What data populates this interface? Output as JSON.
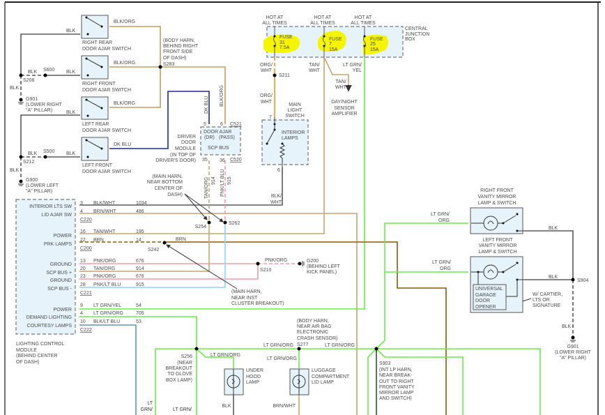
{
  "colors": {
    "blk": "#5a5a5a",
    "blk_org": "#c89a62",
    "org_wht": "#f7941d",
    "tan": "#c8a46e",
    "brn": "#8b5a00",
    "lt_grn": "#66ee44",
    "pnk": "#f59aa5",
    "lt_blu": "#8fd3f4",
    "dk_blu": "#1a2a8c",
    "fuse_highlight": "#f5f500",
    "module_fill": "#e6f3fa"
  },
  "door_switches": [
    {
      "name": [
        "RIGHT REAR",
        "DOOR AJAR SWITCH"
      ],
      "out_wire": "BLK/ORG",
      "in_wire": "BLK"
    },
    {
      "name": [
        "RIGHT FRONT",
        "DOOR AJAR SWITCH"
      ],
      "out_wire": "BLK/ORG",
      "in_wire": "BLK"
    },
    {
      "name": [
        "LEFT REAR",
        "DOOR AJAR SWITCH"
      ],
      "out_wire": "BLK/ORG",
      "in_wire": "BLK"
    },
    {
      "name": [
        "LEFT FRONT",
        "DOOR AJAR SWITCH"
      ],
      "out_wire": "DK BLU",
      "in_wire": "BLK"
    }
  ],
  "splices": {
    "s208": "S208",
    "s600": "S600",
    "s212": "S212",
    "s500": "S500",
    "s283": "S283",
    "s211": "S211",
    "s254": "S254",
    "s262": "S262",
    "s242": "S242",
    "s210": "S210",
    "s256": "S256",
    "s277": "S277",
    "s903": "S903",
    "s904": "S904"
  },
  "grounds": {
    "g901_left": [
      "G901",
      "(LOWER RIGHT",
      "\"A\" PILLAR)"
    ],
    "g900": [
      "G900",
      "(LOWER LEFT",
      "\"A\" PILLAR)"
    ],
    "g200": [
      "G200",
      "(BEHIND LEFT",
      "KICK PANEL)"
    ],
    "g901_right": [
      "G901",
      "(LOWER RIGHT",
      "\"A\" PILLAR)"
    ]
  },
  "notes": {
    "s283": [
      "(BODY HARN,",
      "BEHIND RIGHT",
      "FRONT SIDE",
      "OF DASH)"
    ],
    "main_harn_bottom": [
      "(MAIN HARN,",
      "NEAR BOTTOM",
      "CENTER OF",
      "DASH)"
    ],
    "main_harn_inst": [
      "(MAIN HARN,",
      "NEAR INST",
      "CLUSTER BREAKOUT)"
    ],
    "s256": [
      "(NEAR",
      "BREAKOUT",
      "TO GLOVE",
      "BOX LAMP)"
    ],
    "s277": [
      "(BODY HARN,",
      "NEAR AIR BAG",
      "ELECTRONIC",
      "CRASH SENSOR)"
    ],
    "s903": [
      "(INT LP HARN,",
      "NEAR BREAK-",
      "OUT TO RIGHT",
      "FRONT VANITY",
      "MIRROR LAMP",
      "AND SWITCH)"
    ],
    "cartier": [
      "W/ CARTIER,",
      "LTS OR",
      "SIGNATURE"
    ]
  },
  "wires": {
    "blk": "BLK",
    "blk_org": "BLK/ORG",
    "dk_blu": "DK BLU",
    "org_wht": [
      "ORG/",
      "WHT"
    ],
    "tan_wht": [
      "TAN/",
      "WHT"
    ],
    "lt_grn_yel": [
      "LT GRN/",
      "YEL"
    ],
    "tan_org": "TAN/ORG",
    "tan_org_num": "914",
    "pnk_lt_blu": "PNK/LT BLU",
    "pnk_lt_blu_num": "915",
    "blk_wht": [
      "BLK/",
      "WHT"
    ],
    "brn": "BRN",
    "pnk_org": "PNK/ORG",
    "lt_grn_org": "LT GRN/ORG",
    "lt_grn_org_split": [
      "LT GRN/",
      "ORG"
    ],
    "lt_grn_partial": [
      "LT",
      "GRN/"
    ],
    "lt_grn_partial2": "LT GRN/",
    "brn_wht": "BRN/WHT"
  },
  "driver_door_module": {
    "name": [
      "DRIVER",
      "DOOR",
      "MODULE",
      "(IN TOP OF",
      "DRIVER'S DOOR)"
    ],
    "door_ajar": "DOOR AJAR",
    "dr": "(DR)",
    "pass": "(PASS)",
    "scp_bus": "SCP BUS",
    "pins": {
      "p5": "5",
      "p6": "6",
      "p35": "35",
      "p36": "36"
    },
    "c521": "C521",
    "c520": "C520"
  },
  "central_junction_box": {
    "name": [
      "CENTRAL",
      "JUNCTION",
      "BOX"
    ],
    "hot": [
      "HOT AT",
      "ALL TIMES"
    ],
    "fuses": [
      {
        "label": "FUSE",
        "num": "31",
        "amps": "7.5A"
      },
      {
        "label": "FUSE",
        "num": "7",
        "amps": "15A"
      },
      {
        "label": "FUSE",
        "num": "25",
        "amps": "15A"
      }
    ]
  },
  "day_night_sensor": [
    "DAY/NIGHT",
    "SENSOR",
    "AMPLIFIER"
  ],
  "main_light_switch": {
    "name": [
      "MAIN",
      "LIGHT",
      "SWITCH"
    ],
    "interior": [
      "INTERIOR",
      "LAMPS"
    ],
    "pin7": "7",
    "pin6": "6"
  },
  "lighting_control_module": {
    "name": [
      "LIGHTING CONTROL",
      "MODULE",
      "(BEHIND CENTER",
      "OF DASH)"
    ],
    "pins": [
      {
        "func": "INTERIOR LTS SW",
        "pin": "3",
        "wire": "BLK/WHT",
        "circuit": "1034"
      },
      {
        "func": "LID AJAR SW",
        "pin": "4",
        "wire": "BRN/WHT",
        "circuit": "486"
      },
      {
        "func": "POWER",
        "pin": "16",
        "wire": "TAN/WHT",
        "circuit": "195"
      },
      {
        "func": "PRK LAMPS",
        "pin": "22",
        "wire": "BRN",
        "circuit": "14"
      },
      {
        "func": "GROUND",
        "pin": "13",
        "wire": "PNK/ORG",
        "circuit": "676"
      },
      {
        "func": "SCP BUS +",
        "pin": "20",
        "wire": "TAN/ORG",
        "circuit": "914"
      },
      {
        "func": "GROUND",
        "pin": "23",
        "wire": "PNK/ORG",
        "circuit": "676"
      },
      {
        "func": "SCP BUS -",
        "pin": "28",
        "wire": "PNK/LT BLU",
        "circuit": "915"
      },
      {
        "func": "POWER",
        "pin": "9",
        "wire": "LT GRN/YEL",
        "circuit": "54"
      },
      {
        "func": "DEMAND LIGHTING",
        "pin": "4",
        "wire": "LT GRN/ORG",
        "circuit": "705"
      },
      {
        "func": "COURTESY LAMPS",
        "pin": "10",
        "wire": "BLK/LT BLU",
        "circuit": "53"
      }
    ],
    "connectors": {
      "c220": "C220",
      "c200": "C200",
      "c221": "C221",
      "c222": "C222"
    }
  },
  "vanity_mirrors": {
    "right": [
      "RIGHT FRONT",
      "VANITY MIRROR",
      "LAMP & SWITCH"
    ],
    "left": [
      "LEFT FRONT",
      "VANITY MIRROR",
      "LAMP & SWITCH"
    ],
    "garage": [
      "UNIVERSAL",
      "GARAGE",
      "DOOR",
      "OPENER"
    ]
  },
  "lamps": {
    "under_hood": [
      "UNDER",
      "HOOD",
      "LAMP"
    ],
    "luggage": [
      "LUGGAGE",
      "COMPARTMENT",
      "LID LAMP"
    ]
  }
}
